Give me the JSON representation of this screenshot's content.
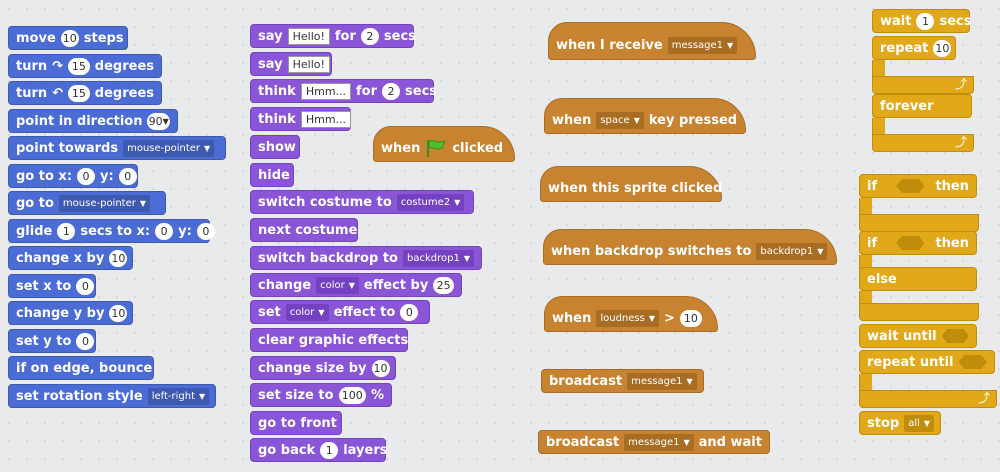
{
  "motion": {
    "move": {
      "a": "move",
      "n": "10",
      "b": "steps"
    },
    "turn_right": {
      "a": "turn",
      "n": "15",
      "b": "degrees"
    },
    "turn_left": {
      "a": "turn",
      "n": "15",
      "b": "degrees"
    },
    "point_dir": {
      "a": "point in direction",
      "v": "90"
    },
    "point_towards": {
      "a": "point towards",
      "v": "mouse-pointer"
    },
    "goto_xy": {
      "a": "go to x:",
      "x": "0",
      "y_label": "y:",
      "y": "0"
    },
    "goto": {
      "a": "go to",
      "v": "mouse-pointer"
    },
    "glide": {
      "a": "glide",
      "n": "1",
      "b": "secs to x:",
      "x": "0",
      "y_label": "y:",
      "y": "0"
    },
    "change_x": {
      "a": "change x by",
      "n": "10"
    },
    "set_x": {
      "a": "set x to",
      "n": "0"
    },
    "change_y": {
      "a": "change y by",
      "n": "10"
    },
    "set_y": {
      "a": "set y to",
      "n": "0"
    },
    "bounce": {
      "a": "if on edge, bounce"
    },
    "rotation": {
      "a": "set rotation style",
      "v": "left-right"
    }
  },
  "looks": {
    "say_secs": {
      "a": "say",
      "t": "Hello!",
      "b": "for",
      "n": "2",
      "c": "secs"
    },
    "say": {
      "a": "say",
      "t": "Hello!"
    },
    "think_secs": {
      "a": "think",
      "t": "Hmm...",
      "b": "for",
      "n": "2",
      "c": "secs"
    },
    "think": {
      "a": "think",
      "t": "Hmm..."
    },
    "show": {
      "a": "show"
    },
    "hide": {
      "a": "hide"
    },
    "switch_costume": {
      "a": "switch costume to",
      "v": "costume2"
    },
    "next_costume": {
      "a": "next costume"
    },
    "switch_backdrop": {
      "a": "switch backdrop to",
      "v": "backdrop1"
    },
    "change_effect": {
      "a": "change",
      "v": "color",
      "b": "effect by",
      "n": "25"
    },
    "set_effect": {
      "a": "set",
      "v": "color",
      "b": "effect to",
      "n": "0"
    },
    "clear_effects": {
      "a": "clear graphic effects"
    },
    "change_size": {
      "a": "change size by",
      "n": "10"
    },
    "set_size": {
      "a": "set size to",
      "n": "100",
      "b": "%"
    },
    "front": {
      "a": "go to front"
    },
    "back": {
      "a": "go back",
      "n": "1",
      "b": "layers"
    }
  },
  "events": {
    "flag": {
      "a": "when",
      "b": "clicked"
    },
    "receive": {
      "a": "when I receive",
      "v": "message1"
    },
    "key": {
      "a": "when",
      "v": "space",
      "b": "key pressed"
    },
    "sprite_clicked": {
      "a": "when this sprite clicked"
    },
    "backdrop_switch": {
      "a": "when backdrop switches to",
      "v": "backdrop1"
    },
    "loudness": {
      "a": "when",
      "v": "loudness",
      "b": ">",
      "n": "10"
    },
    "broadcast": {
      "a": "broadcast",
      "v": "message1"
    },
    "broadcast_wait": {
      "a": "broadcast",
      "v": "message1",
      "b": "and wait"
    }
  },
  "control": {
    "wait": {
      "a": "wait",
      "n": "1",
      "b": "secs"
    },
    "repeat": {
      "a": "repeat",
      "n": "10"
    },
    "forever": {
      "a": "forever"
    },
    "if_then": {
      "a": "if",
      "b": "then"
    },
    "if_else": {
      "a": "if",
      "b": "then",
      "c": "else"
    },
    "wait_until": {
      "a": "wait until"
    },
    "repeat_until": {
      "a": "repeat until"
    },
    "stop": {
      "a": "stop",
      "v": "all"
    }
  },
  "colors": {
    "motion": "#4a6cd4",
    "looks": "#8a55d7",
    "events": "#c88330",
    "control": "#e1a91a"
  }
}
